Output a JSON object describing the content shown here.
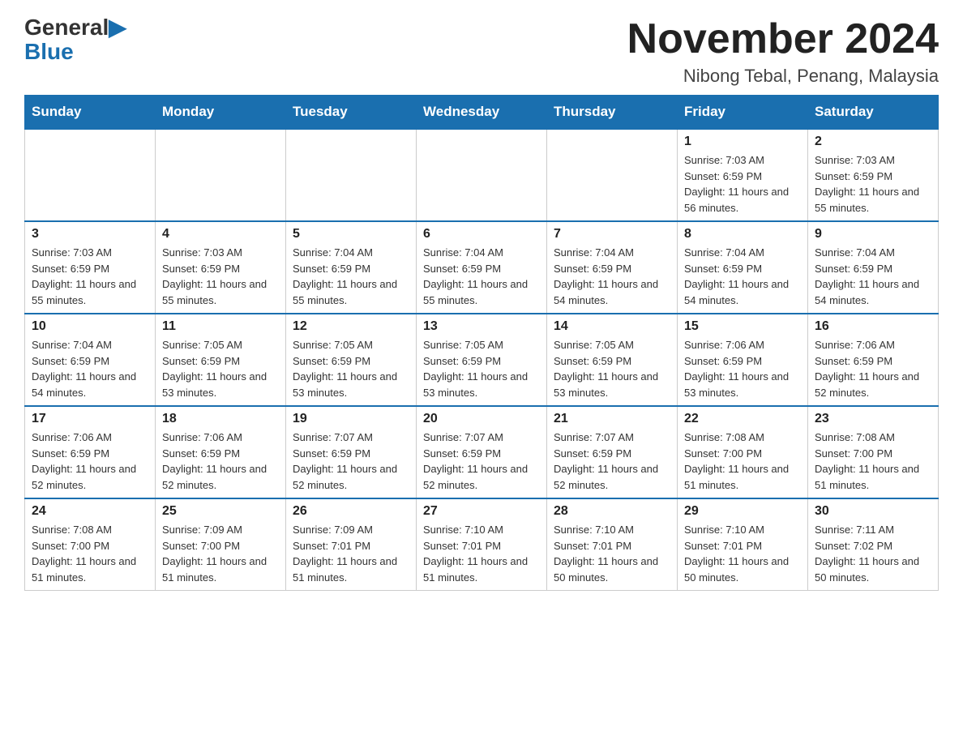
{
  "logo": {
    "general": "General",
    "blue": "Blue",
    "arrow": "▶"
  },
  "header": {
    "title": "November 2024",
    "location": "Nibong Tebal, Penang, Malaysia"
  },
  "weekdays": [
    "Sunday",
    "Monday",
    "Tuesday",
    "Wednesday",
    "Thursday",
    "Friday",
    "Saturday"
  ],
  "weeks": [
    [
      {
        "day": "",
        "info": ""
      },
      {
        "day": "",
        "info": ""
      },
      {
        "day": "",
        "info": ""
      },
      {
        "day": "",
        "info": ""
      },
      {
        "day": "",
        "info": ""
      },
      {
        "day": "1",
        "info": "Sunrise: 7:03 AM\nSunset: 6:59 PM\nDaylight: 11 hours and 56 minutes."
      },
      {
        "day": "2",
        "info": "Sunrise: 7:03 AM\nSunset: 6:59 PM\nDaylight: 11 hours and 55 minutes."
      }
    ],
    [
      {
        "day": "3",
        "info": "Sunrise: 7:03 AM\nSunset: 6:59 PM\nDaylight: 11 hours and 55 minutes."
      },
      {
        "day": "4",
        "info": "Sunrise: 7:03 AM\nSunset: 6:59 PM\nDaylight: 11 hours and 55 minutes."
      },
      {
        "day": "5",
        "info": "Sunrise: 7:04 AM\nSunset: 6:59 PM\nDaylight: 11 hours and 55 minutes."
      },
      {
        "day": "6",
        "info": "Sunrise: 7:04 AM\nSunset: 6:59 PM\nDaylight: 11 hours and 55 minutes."
      },
      {
        "day": "7",
        "info": "Sunrise: 7:04 AM\nSunset: 6:59 PM\nDaylight: 11 hours and 54 minutes."
      },
      {
        "day": "8",
        "info": "Sunrise: 7:04 AM\nSunset: 6:59 PM\nDaylight: 11 hours and 54 minutes."
      },
      {
        "day": "9",
        "info": "Sunrise: 7:04 AM\nSunset: 6:59 PM\nDaylight: 11 hours and 54 minutes."
      }
    ],
    [
      {
        "day": "10",
        "info": "Sunrise: 7:04 AM\nSunset: 6:59 PM\nDaylight: 11 hours and 54 minutes."
      },
      {
        "day": "11",
        "info": "Sunrise: 7:05 AM\nSunset: 6:59 PM\nDaylight: 11 hours and 53 minutes."
      },
      {
        "day": "12",
        "info": "Sunrise: 7:05 AM\nSunset: 6:59 PM\nDaylight: 11 hours and 53 minutes."
      },
      {
        "day": "13",
        "info": "Sunrise: 7:05 AM\nSunset: 6:59 PM\nDaylight: 11 hours and 53 minutes."
      },
      {
        "day": "14",
        "info": "Sunrise: 7:05 AM\nSunset: 6:59 PM\nDaylight: 11 hours and 53 minutes."
      },
      {
        "day": "15",
        "info": "Sunrise: 7:06 AM\nSunset: 6:59 PM\nDaylight: 11 hours and 53 minutes."
      },
      {
        "day": "16",
        "info": "Sunrise: 7:06 AM\nSunset: 6:59 PM\nDaylight: 11 hours and 52 minutes."
      }
    ],
    [
      {
        "day": "17",
        "info": "Sunrise: 7:06 AM\nSunset: 6:59 PM\nDaylight: 11 hours and 52 minutes."
      },
      {
        "day": "18",
        "info": "Sunrise: 7:06 AM\nSunset: 6:59 PM\nDaylight: 11 hours and 52 minutes."
      },
      {
        "day": "19",
        "info": "Sunrise: 7:07 AM\nSunset: 6:59 PM\nDaylight: 11 hours and 52 minutes."
      },
      {
        "day": "20",
        "info": "Sunrise: 7:07 AM\nSunset: 6:59 PM\nDaylight: 11 hours and 52 minutes."
      },
      {
        "day": "21",
        "info": "Sunrise: 7:07 AM\nSunset: 6:59 PM\nDaylight: 11 hours and 52 minutes."
      },
      {
        "day": "22",
        "info": "Sunrise: 7:08 AM\nSunset: 7:00 PM\nDaylight: 11 hours and 51 minutes."
      },
      {
        "day": "23",
        "info": "Sunrise: 7:08 AM\nSunset: 7:00 PM\nDaylight: 11 hours and 51 minutes."
      }
    ],
    [
      {
        "day": "24",
        "info": "Sunrise: 7:08 AM\nSunset: 7:00 PM\nDaylight: 11 hours and 51 minutes."
      },
      {
        "day": "25",
        "info": "Sunrise: 7:09 AM\nSunset: 7:00 PM\nDaylight: 11 hours and 51 minutes."
      },
      {
        "day": "26",
        "info": "Sunrise: 7:09 AM\nSunset: 7:01 PM\nDaylight: 11 hours and 51 minutes."
      },
      {
        "day": "27",
        "info": "Sunrise: 7:10 AM\nSunset: 7:01 PM\nDaylight: 11 hours and 51 minutes."
      },
      {
        "day": "28",
        "info": "Sunrise: 7:10 AM\nSunset: 7:01 PM\nDaylight: 11 hours and 50 minutes."
      },
      {
        "day": "29",
        "info": "Sunrise: 7:10 AM\nSunset: 7:01 PM\nDaylight: 11 hours and 50 minutes."
      },
      {
        "day": "30",
        "info": "Sunrise: 7:11 AM\nSunset: 7:02 PM\nDaylight: 11 hours and 50 minutes."
      }
    ]
  ]
}
